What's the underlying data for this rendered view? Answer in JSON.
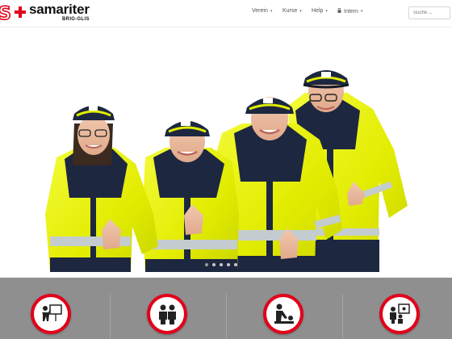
{
  "logo": {
    "name": "samariter",
    "subtitle": "BRIG-GLIS",
    "mark": "S"
  },
  "nav": [
    {
      "label": "Verein",
      "caret": "▾"
    },
    {
      "label": "Kurse",
      "caret": "▾"
    },
    {
      "label": "Help",
      "caret": "▾"
    },
    {
      "label": "Intern",
      "caret": "▾",
      "icon": "lock-icon"
    }
  ],
  "search": {
    "placeholder": "Suche ..."
  },
  "colors": {
    "brand_red": "#e2001a",
    "band_gray": "#8f8f8f",
    "jacket_yellow": "#e6f000",
    "navy": "#1d2740"
  },
  "slider": {
    "dot_count": 5,
    "active_index": 0
  },
  "services": [
    {
      "icon": "presentation-icon"
    },
    {
      "icon": "people-icon"
    },
    {
      "icon": "first-aid-icon"
    },
    {
      "icon": "teacher-icon"
    }
  ]
}
